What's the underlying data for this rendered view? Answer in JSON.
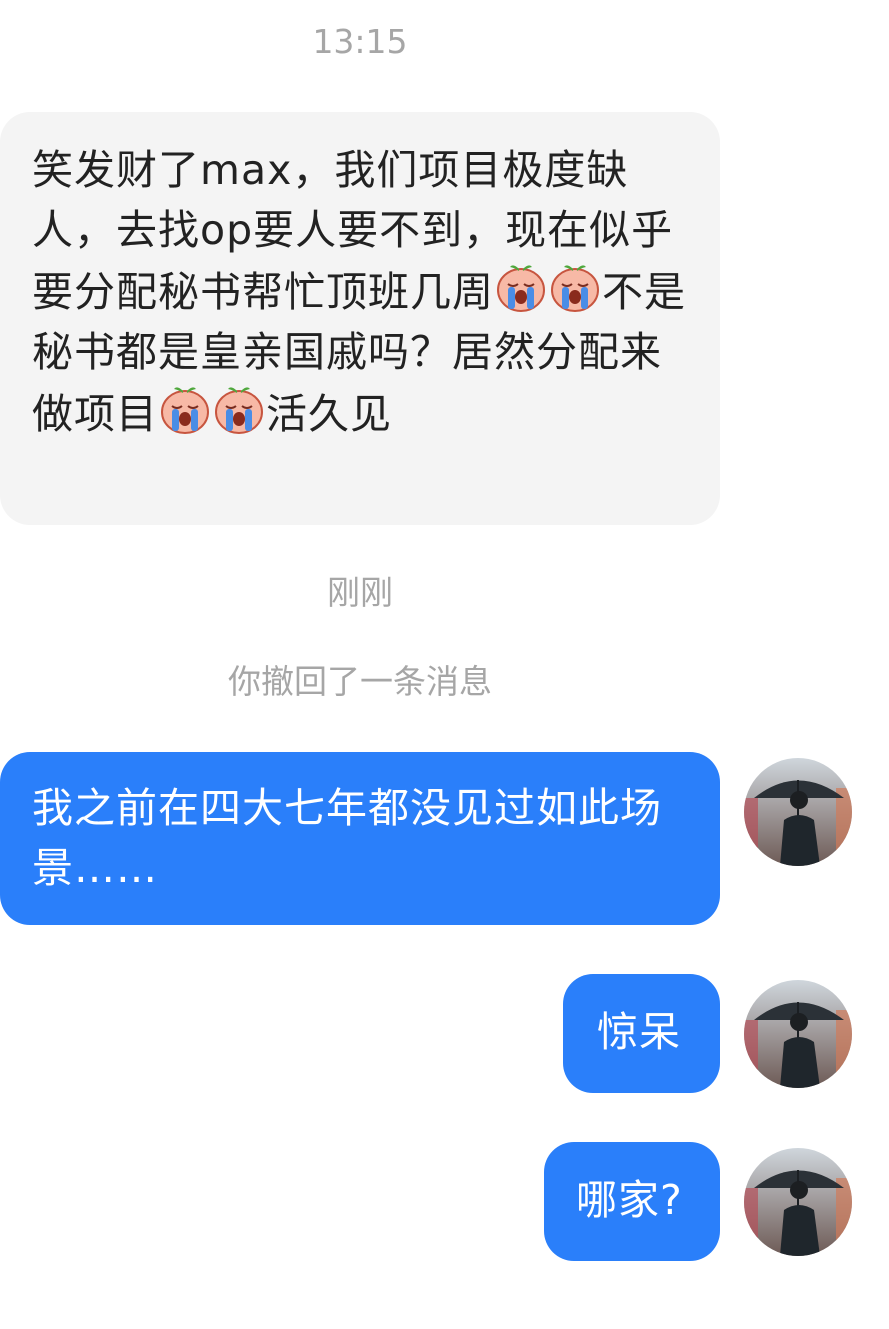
{
  "timestamps": {
    "first": "13:15",
    "second": "刚刚"
  },
  "system_notice": "你撤回了一条消息",
  "incoming_message": {
    "part1": "笑发财了max，我们项目极度缺人，去找op要人要不到，现在似乎要分配秘书帮忙顶班几周",
    "emoji1": "crying-face-emoji",
    "part2": "不是秘书都是皇亲国戚吗？居然分配来做项目",
    "emoji2": "crying-face-emoji",
    "part3": "活久见"
  },
  "outgoing_messages": [
    {
      "text": "我之前在四大七年都没见过如此场景……"
    },
    {
      "text": "惊呆"
    },
    {
      "text": "哪家?"
    }
  ],
  "colors": {
    "outgoing_bubble": "#2a7ffa",
    "incoming_bubble": "#f4f4f4",
    "timestamp_text": "#a6a6a6"
  },
  "icons": {
    "avatar": "man-with-umbrella-avatar",
    "emoji": "crying-face-emoji"
  }
}
